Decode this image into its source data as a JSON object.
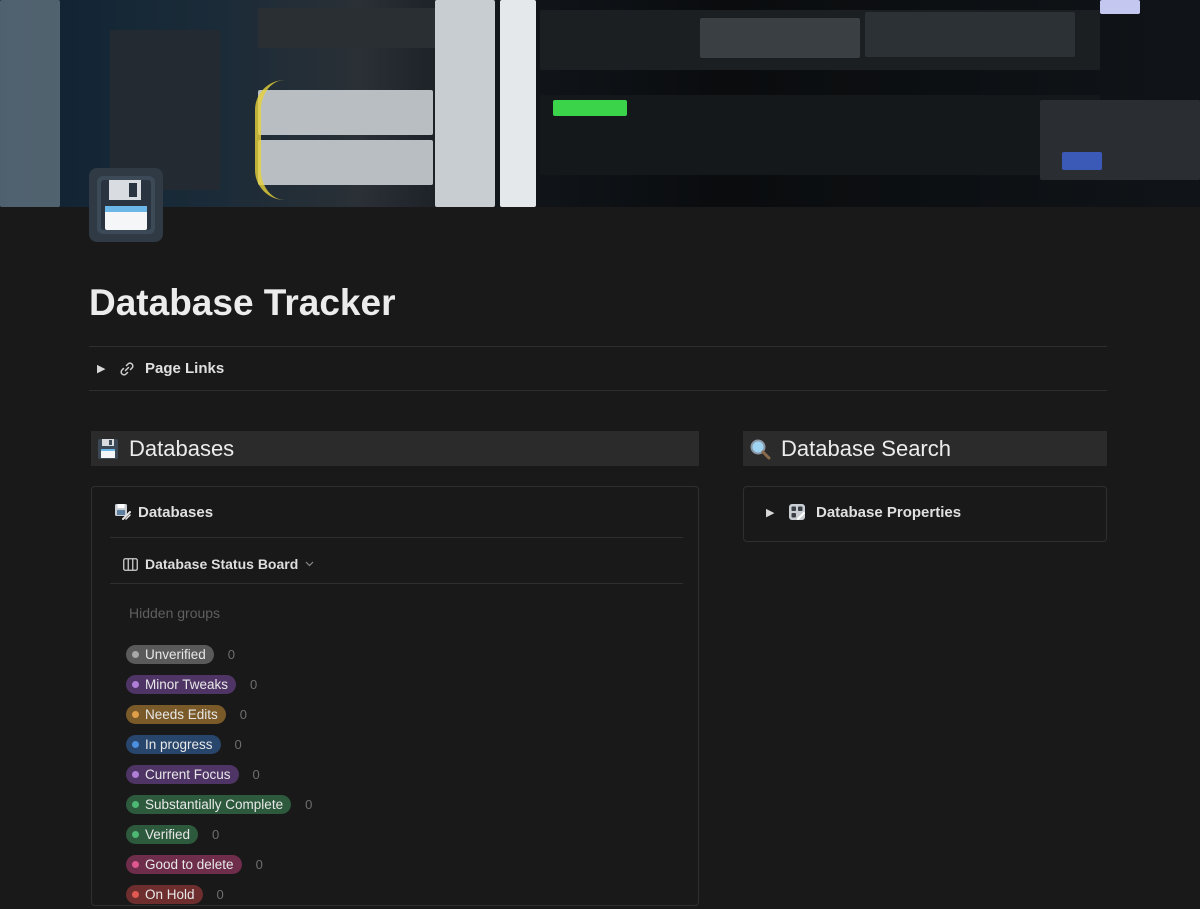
{
  "page": {
    "title": "Database Tracker",
    "icon": "floppy-disk-icon"
  },
  "page_links": {
    "label": "Page Links",
    "icon": "link-icon"
  },
  "databases_section": {
    "heading": "Databases",
    "icon": "floppy-disk-icon",
    "card_title": "Databases",
    "card_icon": "database-card-icon",
    "view": {
      "label": "Database Status Board",
      "icon": "board-icon"
    },
    "hidden_groups_label": "Hidden groups",
    "groups": [
      {
        "label": "Unverified",
        "count": "0",
        "bg": "#5a5a5a",
        "dot": "#a8a8a8"
      },
      {
        "label": "Minor Tweaks",
        "count": "0",
        "bg": "#4f3466",
        "dot": "#b07ed6"
      },
      {
        "label": "Needs Edits",
        "count": "0",
        "bg": "#7a5a28",
        "dot": "#e0a04a"
      },
      {
        "label": "In progress",
        "count": "0",
        "bg": "#28456b",
        "dot": "#4a8fe0"
      },
      {
        "label": "Current Focus",
        "count": "0",
        "bg": "#4f3466",
        "dot": "#b07ed6"
      },
      {
        "label": "Substantially Complete",
        "count": "0",
        "bg": "#2d5a3d",
        "dot": "#4cb873"
      },
      {
        "label": "Verified",
        "count": "0",
        "bg": "#2d5a3d",
        "dot": "#4cb873"
      },
      {
        "label": "Good to delete",
        "count": "0",
        "bg": "#6e2d4a",
        "dot": "#e0578f"
      },
      {
        "label": "On Hold",
        "count": "0",
        "bg": "#6e2e2e",
        "dot": "#e05a52"
      }
    ]
  },
  "search_section": {
    "heading": "Database Search",
    "icon": "magnifier-icon",
    "toggle_label": "Database Properties",
    "toggle_icon": "properties-icon"
  }
}
